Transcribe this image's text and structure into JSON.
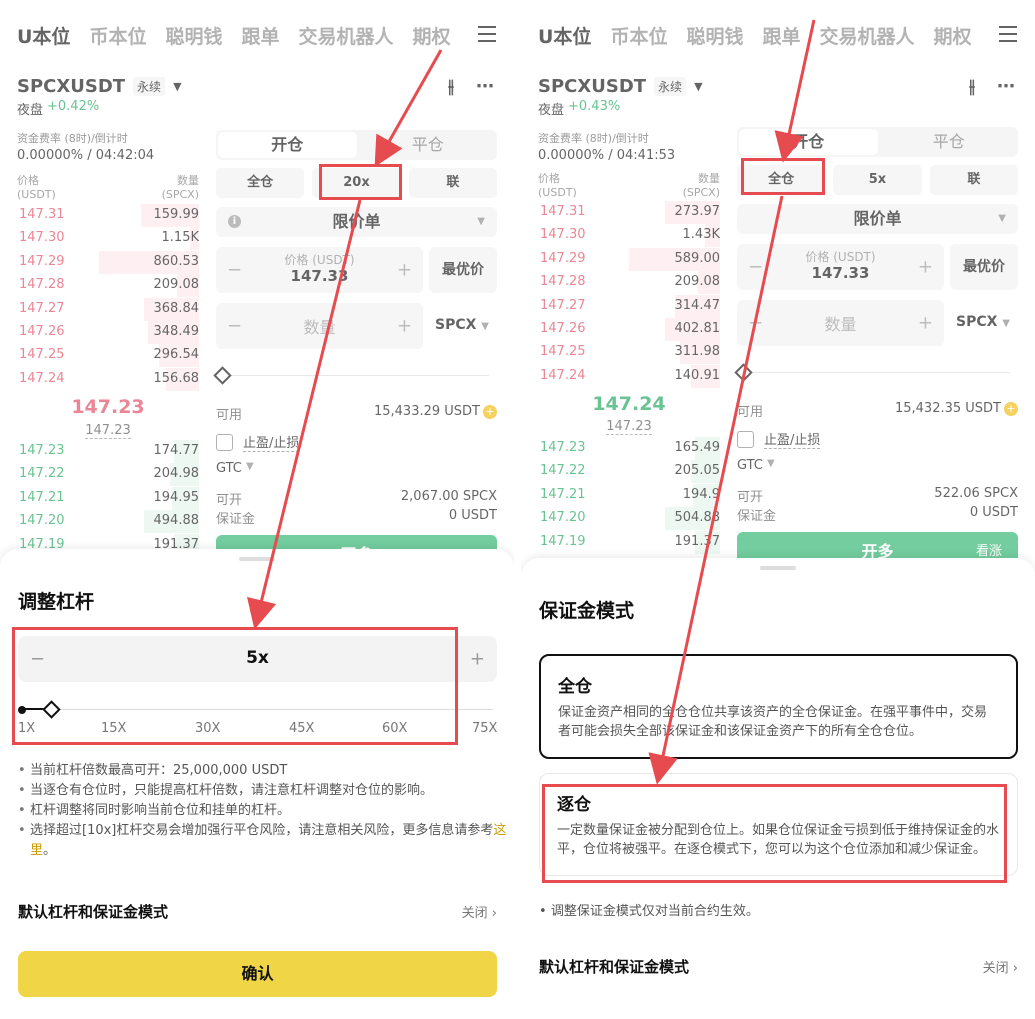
{
  "nav_tabs": [
    "U本位",
    "币本位",
    "聪明钱",
    "跟单",
    "交易机器人",
    "期权"
  ],
  "left": {
    "symbol": "SPCXUSDT",
    "perp_label": "永续",
    "session": "夜盘",
    "change": "+0.42%",
    "funding_label": "资金费率 (8时)/倒计时",
    "funding_value": "0.00000% / 04:42:04",
    "ob_price_head": "价格",
    "ob_price_unit": "(USDT)",
    "ob_qty_head": "数量",
    "ob_qty_unit": "(SPCX)",
    "asks": [
      {
        "price": "147.31",
        "qty": "159.99",
        "depth": 0.32
      },
      {
        "price": "147.30",
        "qty": "1.15K",
        "depth": 0.05
      },
      {
        "price": "147.29",
        "qty": "860.53",
        "depth": 0.55
      },
      {
        "price": "147.28",
        "qty": "209.08",
        "depth": 0.12
      },
      {
        "price": "147.27",
        "qty": "368.84",
        "depth": 0.3
      },
      {
        "price": "147.26",
        "qty": "348.49",
        "depth": 0.28
      },
      {
        "price": "147.25",
        "qty": "296.54",
        "depth": 0.22
      },
      {
        "price": "147.24",
        "qty": "156.68",
        "depth": 0.18
      }
    ],
    "mid_price": "147.23",
    "mark_price": "147.23",
    "bids": [
      {
        "price": "147.23",
        "qty": "174.77",
        "depth": 0.14
      },
      {
        "price": "147.22",
        "qty": "204.98",
        "depth": 0.16
      },
      {
        "price": "147.21",
        "qty": "194.95",
        "depth": 0.15
      },
      {
        "price": "147.20",
        "qty": "494.88",
        "depth": 0.3
      },
      {
        "price": "147.19",
        "qty": "191.37",
        "depth": 0.14
      }
    ],
    "open_tab": "开仓",
    "close_tab": "平仓",
    "margin_mode_btn": "全仓",
    "leverage_btn": "20x",
    "assets_btn": "联",
    "order_type": "限价单",
    "price_label": "价格 (USDT)",
    "price_value": "147.33",
    "best_price": "最优价",
    "qty_label": "数量",
    "qty_unit": "SPCX",
    "available_label": "可用",
    "available_value": "15,433.29 USDT",
    "tpsl_label": "止盈/止损",
    "tif": "GTC",
    "can_open_label": "可开",
    "can_open_value": "2,067.00 SPCX",
    "margin_label": "保证金",
    "margin_value": "0 USDT",
    "open_long": "开多",
    "sheet": {
      "title": "调整杠杆",
      "leverage_value": "5x",
      "minus": "−",
      "plus": "+",
      "ticks": [
        "1X",
        "15X",
        "30X",
        "45X",
        "60X",
        "75X"
      ],
      "tips": [
        "当前杠杆倍数最高可开：25,000,000 USDT",
        "当逐仓有仓位时，只能提高杠杆倍数，请注意杠杆调整对仓位的影响。",
        "杠杆调整将同时影响当前仓位和挂单的杠杆。",
        "选择超过[10x]杠杆交易会增加强行平仓风险，请注意相关风险，更多信息请参考"
      ],
      "tip_link": "这里",
      "default_row": "默认杠杆和保证金模式",
      "default_row_value": "关闭",
      "confirm": "确认"
    }
  },
  "right": {
    "symbol": "SPCXUSDT",
    "perp_label": "永续",
    "session": "夜盘",
    "change": "+0.43%",
    "funding_label": "资金费率 (8时)/倒计时",
    "funding_value": "0.00000% / 04:41:53",
    "ob_price_head": "价格",
    "ob_price_unit": "(USDT)",
    "ob_qty_head": "数量",
    "ob_qty_unit": "(SPCX)",
    "asks": [
      {
        "price": "147.31",
        "qty": "273.97",
        "depth": 0.3
      },
      {
        "price": "147.30",
        "qty": "1.43K",
        "depth": 0.08
      },
      {
        "price": "147.29",
        "qty": "589.00",
        "depth": 0.5
      },
      {
        "price": "147.28",
        "qty": "209.08",
        "depth": 0.12
      },
      {
        "price": "147.27",
        "qty": "314.47",
        "depth": 0.25
      },
      {
        "price": "147.26",
        "qty": "402.81",
        "depth": 0.3
      },
      {
        "price": "147.25",
        "qty": "311.98",
        "depth": 0.22
      },
      {
        "price": "147.24",
        "qty": "140.91",
        "depth": 0.16
      }
    ],
    "mid_price": "147.24",
    "mark_price": "147.23",
    "bids": [
      {
        "price": "147.23",
        "qty": "165.49",
        "depth": 0.14
      },
      {
        "price": "147.22",
        "qty": "205.05",
        "depth": 0.16
      },
      {
        "price": "147.21",
        "qty": "194.9",
        "depth": 0.15
      },
      {
        "price": "147.20",
        "qty": "504.88",
        "depth": 0.3
      },
      {
        "price": "147.19",
        "qty": "191.37",
        "depth": 0.14
      }
    ],
    "open_tab": "开仓",
    "close_tab": "平仓",
    "margin_mode_btn": "全仓",
    "leverage_btn": "5x",
    "assets_btn": "联",
    "order_type": "限价单",
    "price_label": "价格 (USDT)",
    "price_value": "147.33",
    "best_price": "最优价",
    "qty_label": "数量",
    "qty_unit": "SPCX",
    "available_label": "可用",
    "available_value": "15,432.35 USDT",
    "tpsl_label": "止盈/止损",
    "tif": "GTC",
    "can_open_label": "可开",
    "can_open_value": "522.06 SPCX",
    "margin_label": "保证金",
    "margin_value": "0 USDT",
    "open_long": "开多",
    "open_long_hint": "看涨",
    "sheet": {
      "title": "保证金模式",
      "cross_title": "全仓",
      "cross_desc": "保证金资产相同的全仓仓位共享该资产的全仓保证金。在强平事件中，交易者可能会损失全部该保证金和该保证金资产下的所有全仓仓位。",
      "isolated_title": "逐仓",
      "isolated_desc": "一定数量保证金被分配到仓位上。如果仓位保证金亏损到低于维持保证金的水平，仓位将被强平。在逐仓模式下，您可以为这个仓位添加和减少保证金。",
      "note": "调整保证金模式仅对当前合约生效。",
      "default_row": "默认杠杆和保证金模式",
      "default_row_value": "关闭"
    }
  },
  "colors": {
    "highlight": "#e54b4f",
    "confirm": "#f0d547",
    "buy": "#1aa35a",
    "sell": "#e0455f"
  }
}
